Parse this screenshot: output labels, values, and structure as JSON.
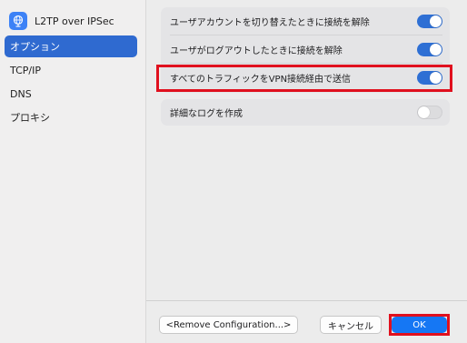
{
  "sidebar": {
    "title": "L2TP over IPSec",
    "icon": "globe-icon",
    "items": [
      {
        "label": "オプション",
        "selected": true
      },
      {
        "label": "TCP/IP",
        "selected": false
      },
      {
        "label": "DNS",
        "selected": false
      },
      {
        "label": "プロキシ",
        "selected": false
      }
    ]
  },
  "options": {
    "group1": [
      {
        "label": "ユーザアカウントを切り替えたときに接続を解除",
        "enabled": true
      },
      {
        "label": "ユーザがログアウトしたときに接続を解除",
        "enabled": true
      },
      {
        "label": "すべてのトラフィックをVPN接続経由で送信",
        "enabled": true
      }
    ],
    "group2": [
      {
        "label": "詳細なログを作成",
        "enabled": false
      }
    ]
  },
  "footer": {
    "remove_label": "<Remove Configuration...>",
    "cancel_label": "キャンセル",
    "ok_label": "OK"
  },
  "colors": {
    "accent": "#2f6ad0",
    "toggle_on": "#2e6fd4",
    "highlight_red": "#e0101e",
    "ok_button": "#1577f4"
  }
}
